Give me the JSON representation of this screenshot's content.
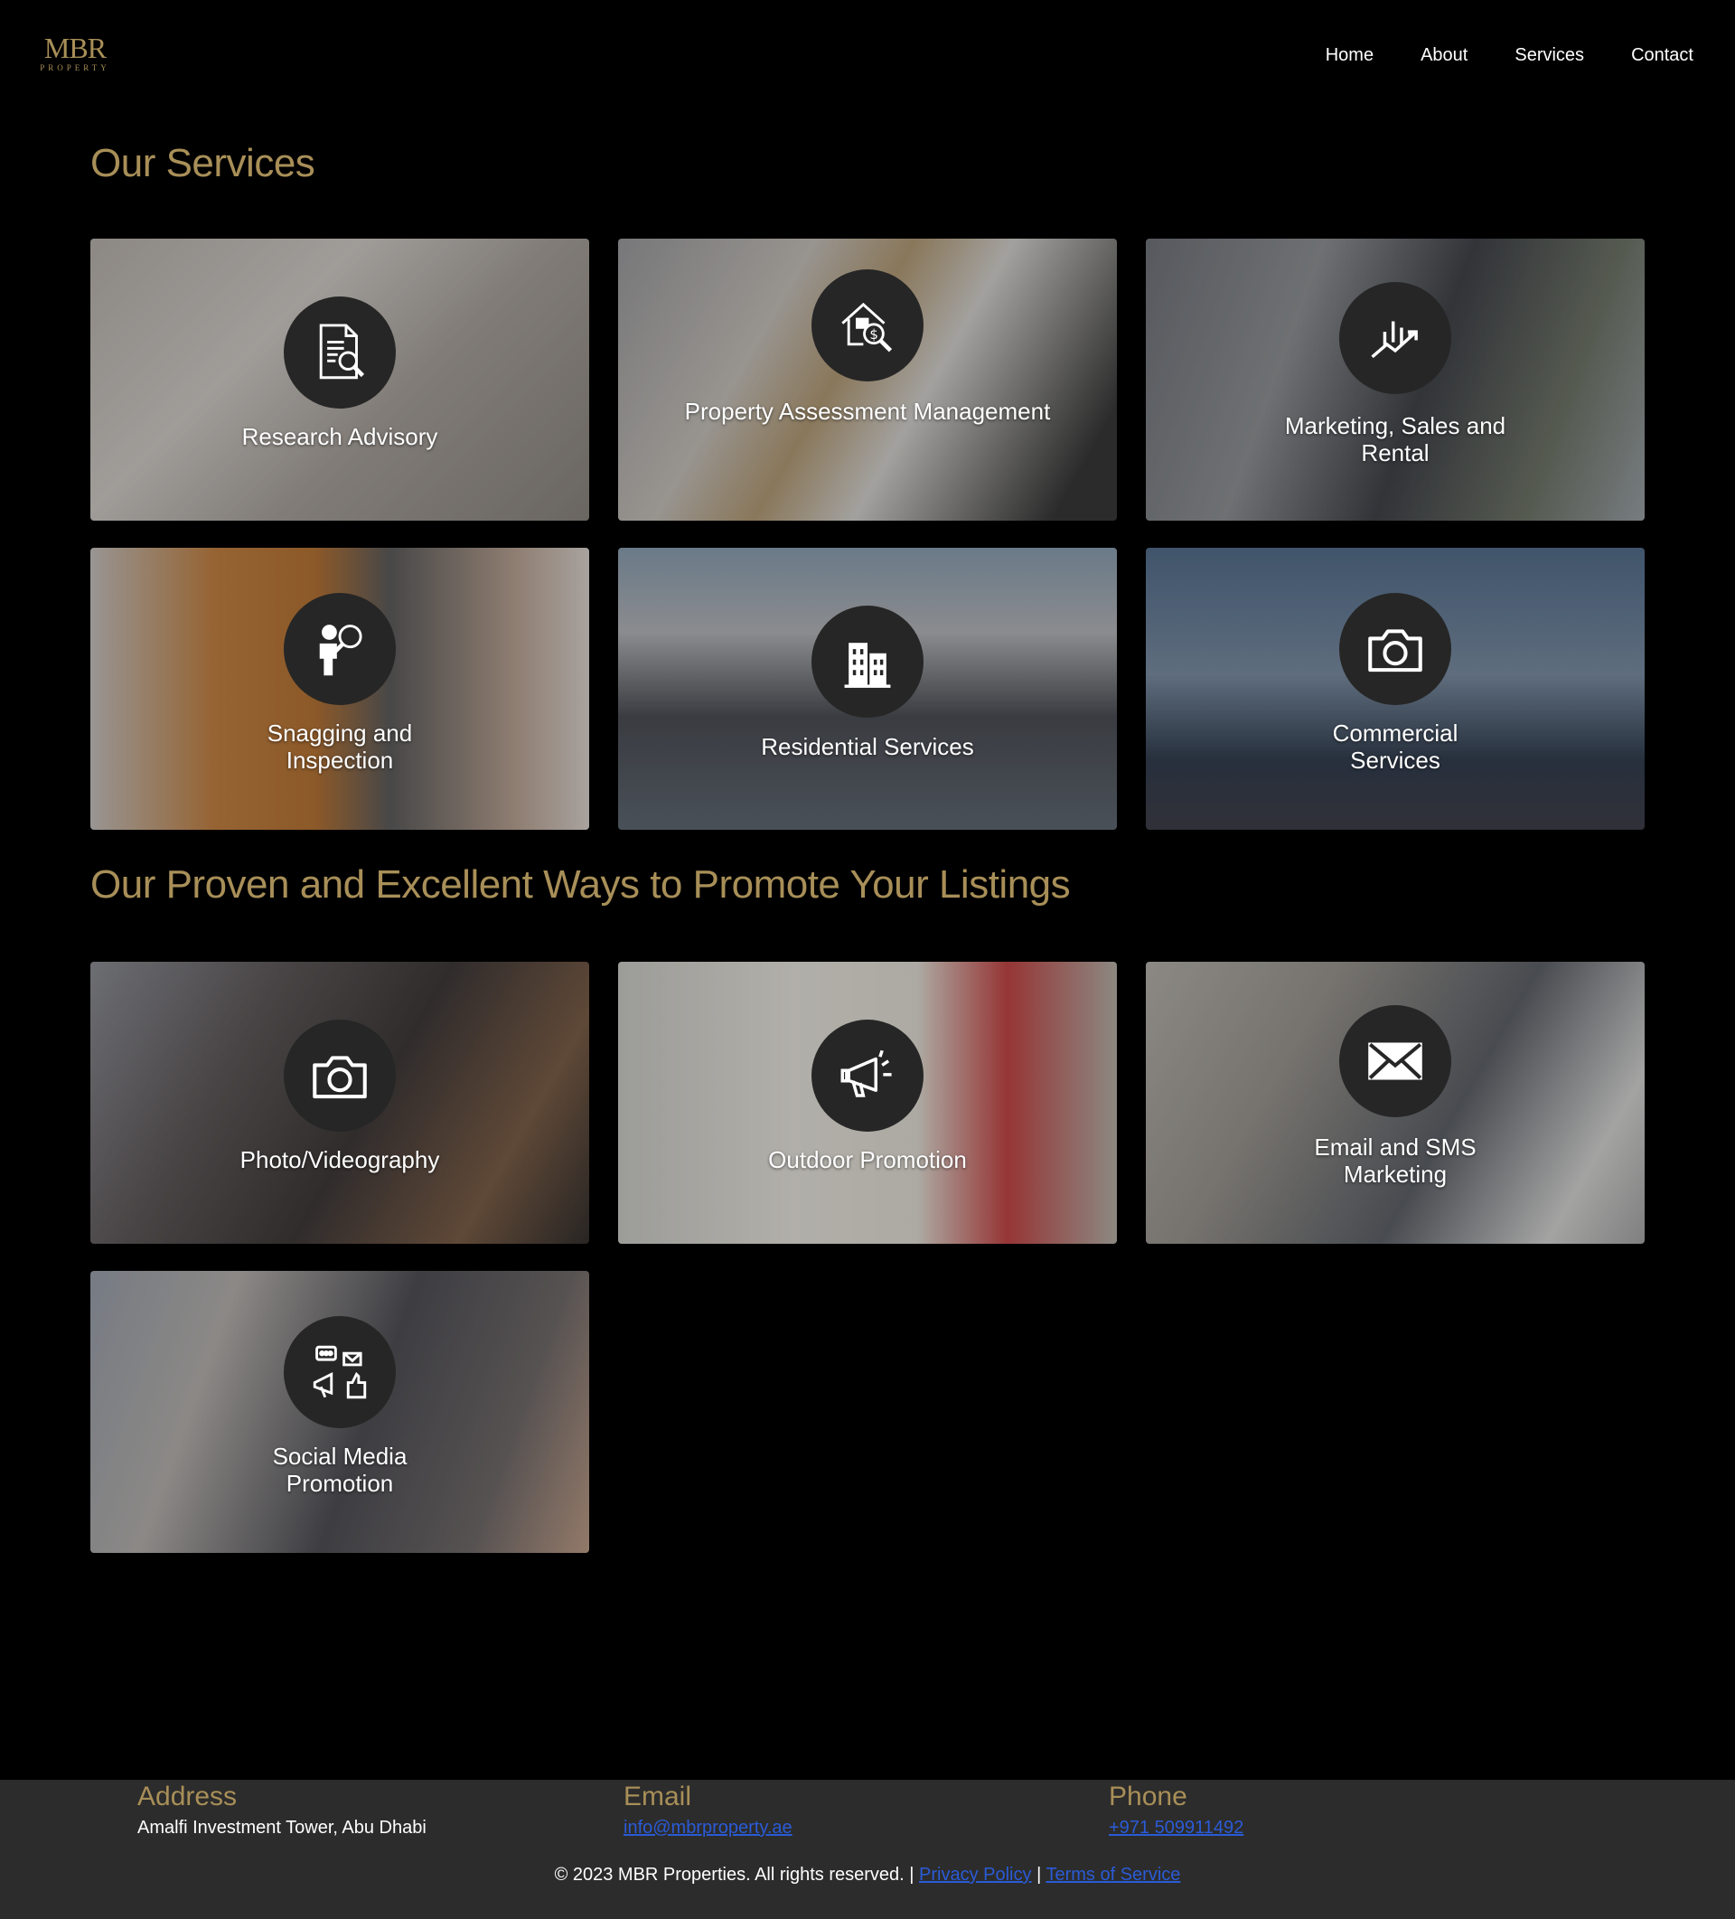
{
  "brand": {
    "logo_main": "MBR",
    "logo_sub": "PROPERTY"
  },
  "nav": {
    "items": [
      "Home",
      "About",
      "Services",
      "Contact"
    ]
  },
  "sections": {
    "services_title": "Our Services",
    "promote_title": "Our Proven and Excellent Ways to Promote Your Listings"
  },
  "services": [
    {
      "label": "Research Advisory",
      "icon": "document-search-icon"
    },
    {
      "label": "Property Assessment Management",
      "icon": "house-dollar-search-icon"
    },
    {
      "label": "Marketing, Sales and Rental",
      "icon": "growth-chart-icon"
    },
    {
      "label": "Snagging and Inspection",
      "icon": "inspector-magnifier-icon"
    },
    {
      "label": "Residential Services",
      "icon": "buildings-icon"
    },
    {
      "label": "Commercial Services",
      "icon": "camera-icon"
    }
  ],
  "promotions": [
    {
      "label": "Photo/Videography",
      "icon": "camera-icon"
    },
    {
      "label": "Outdoor Promotion",
      "icon": "megaphone-icon"
    },
    {
      "label": "Email and SMS Marketing",
      "icon": "envelope-icon"
    },
    {
      "label": "Social Media Promotion",
      "icon": "social-media-icon"
    }
  ],
  "footer": {
    "address_heading": "Address",
    "address_value": "Amalfi Investment Tower, Abu Dhabi",
    "email_heading": "Email",
    "email_value": "info@mbrproperty.ae",
    "phone_heading": "Phone",
    "phone_value": "+971 509911492",
    "copyright": "© 2023 MBR Properties. All rights reserved. |",
    "privacy": "Privacy Policy",
    "separator": "|",
    "terms": "Terms of Service"
  },
  "colors": {
    "gold": "#a88f58",
    "background": "#000000",
    "footer_bg": "#2c2c2c",
    "link": "#2a5bd7"
  }
}
